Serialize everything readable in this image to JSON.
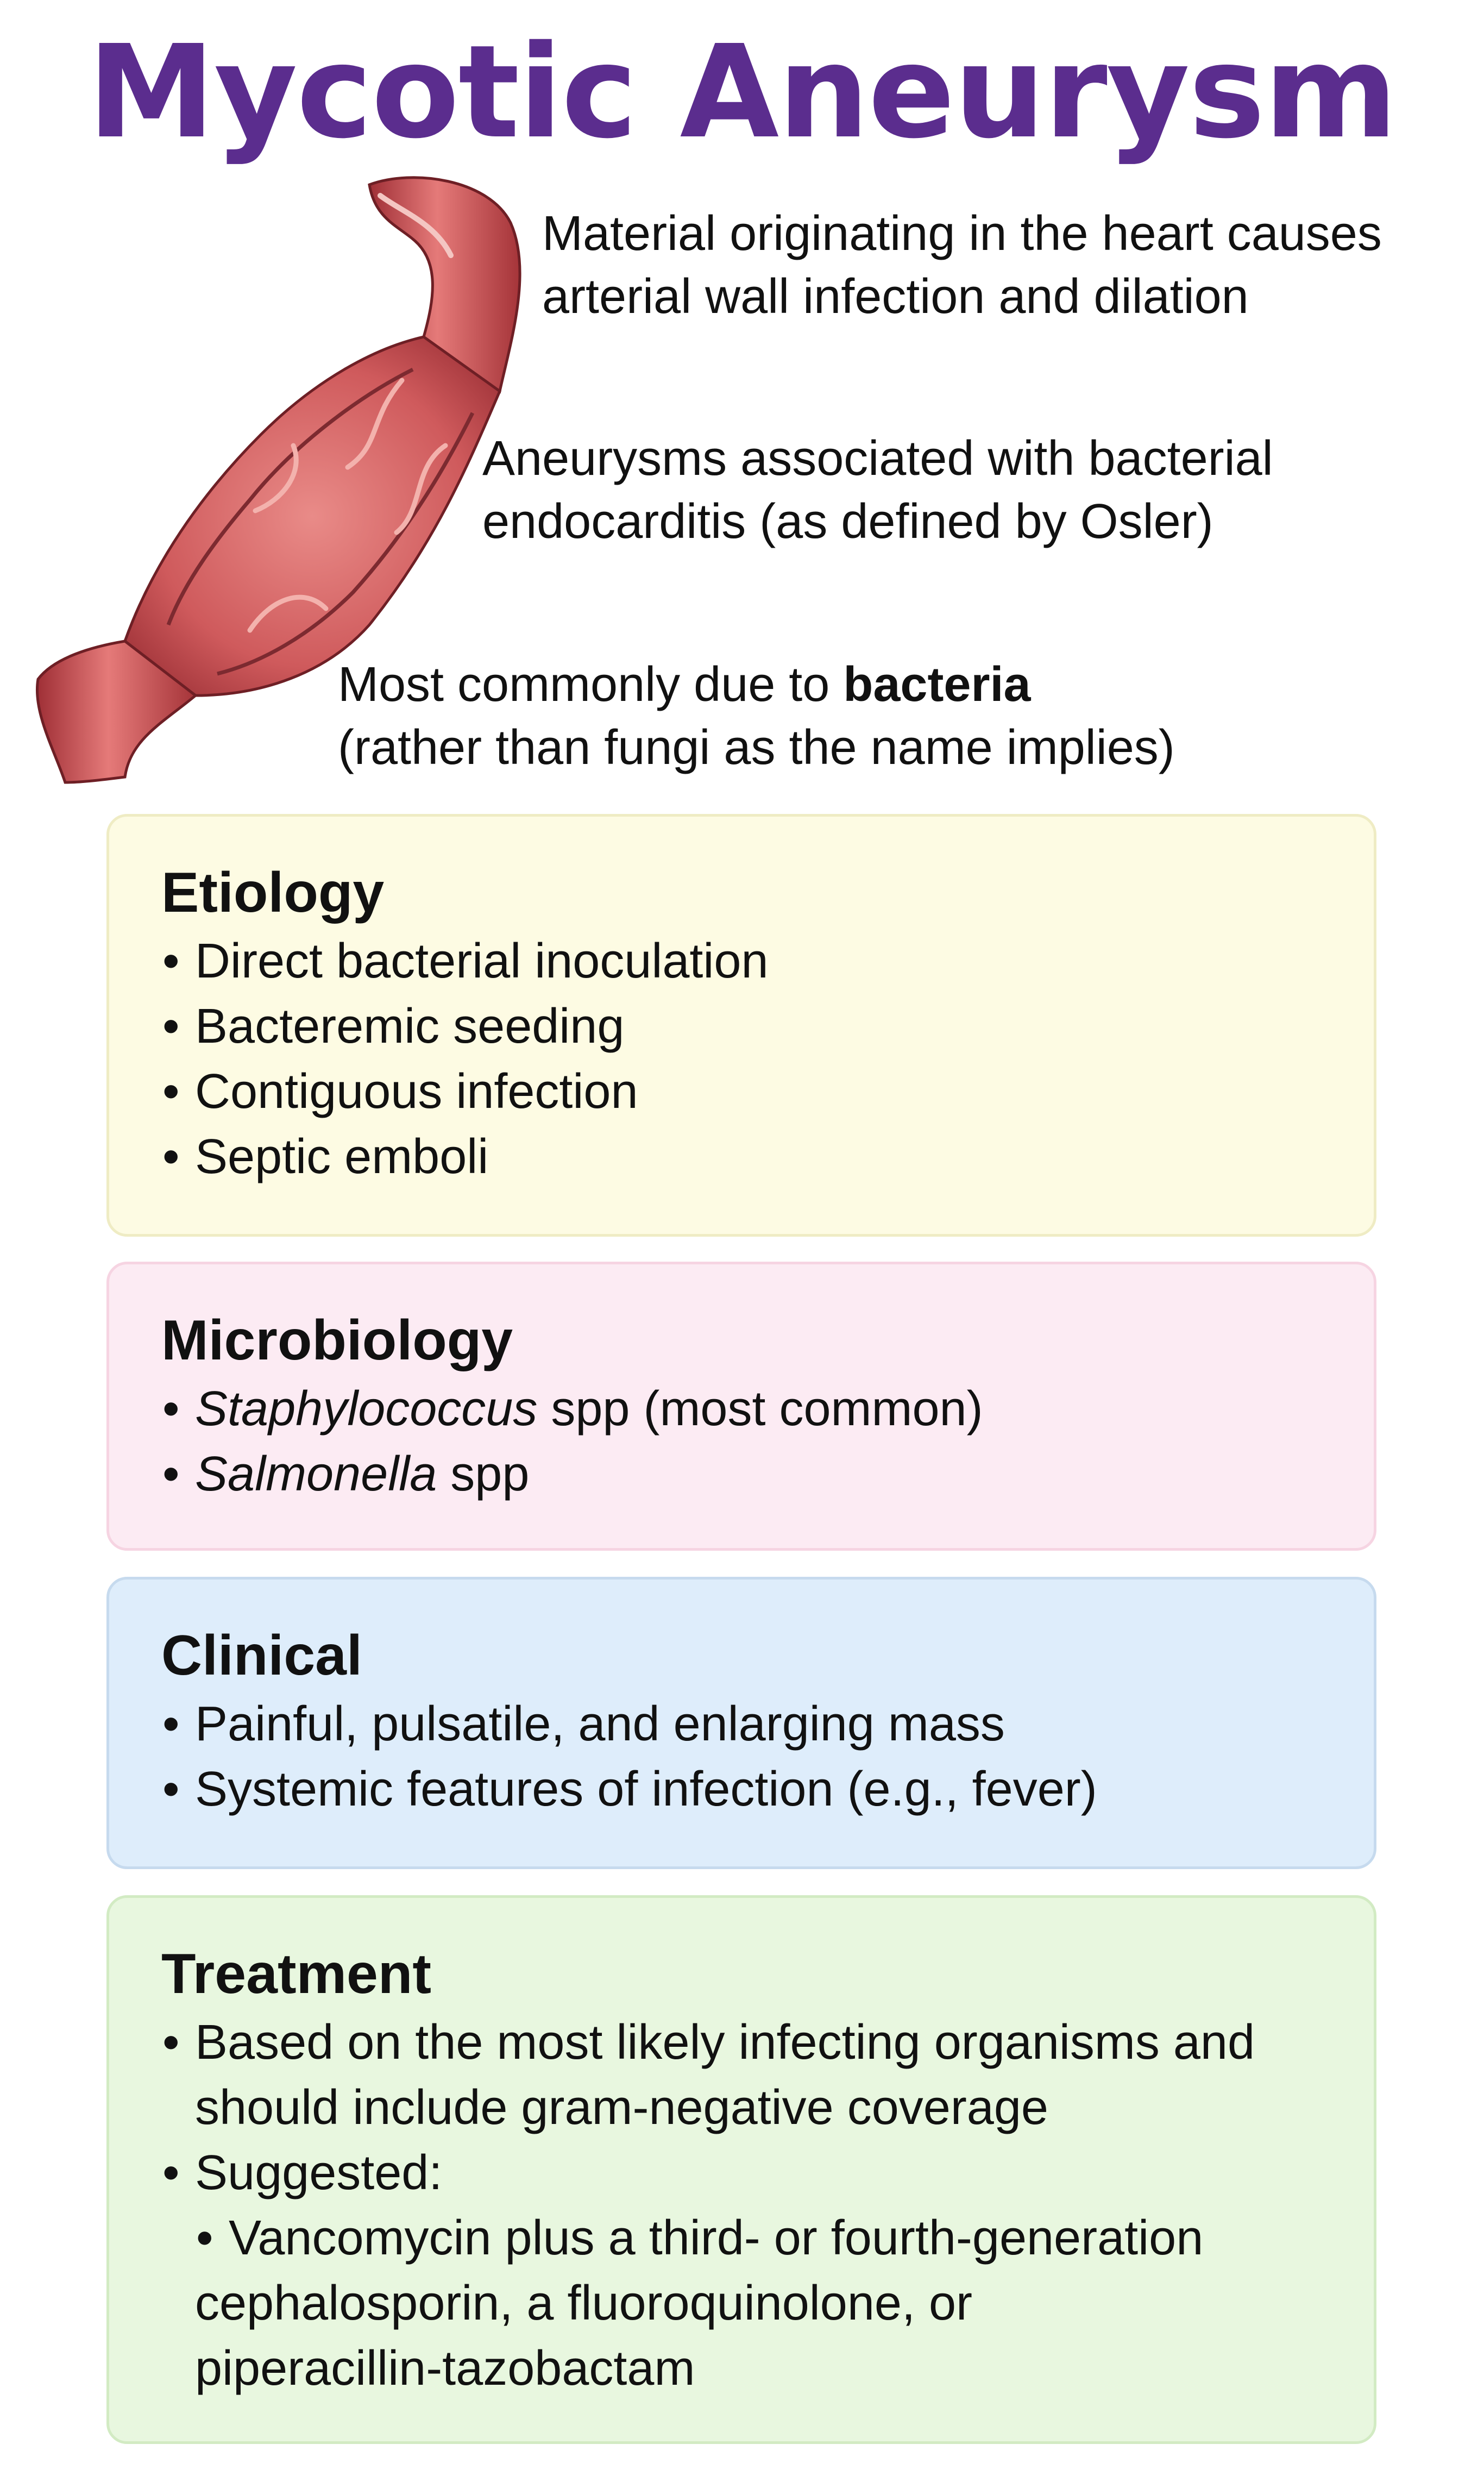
{
  "title": "Mycotic Aneurysm",
  "intro": {
    "line1a": "Material originating in the heart causes",
    "line1b": "arterial wall infection and dilation",
    "line2a": "Aneurysms associated with bacterial",
    "line2b": "endocarditis (as defined by Osler)",
    "line3a_pre": "Most commonly due to ",
    "line3a_bold": "bacteria",
    "line3b": "(rather than fungi as the name implies)"
  },
  "etiology": {
    "heading": "Etiology",
    "items": [
      "Direct bacterial inoculation",
      "Bacteremic seeding",
      "Contiguous infection",
      "Septic emboli"
    ]
  },
  "microbiology": {
    "heading": "Microbiology",
    "items": [
      {
        "italic": "Staphylococcus",
        "rest": " spp (most common)"
      },
      {
        "italic": "Salmonella",
        "rest": " spp"
      }
    ]
  },
  "clinical": {
    "heading": "Clinical",
    "items": [
      "Painful, pulsatile, and enlarging mass",
      "Systemic features of infection (e.g., fever)"
    ]
  },
  "treatment": {
    "heading": "Treatment",
    "item1a": "Based on the most likely infecting organisms and",
    "item1b": "should include gram-negative coverage",
    "item2": "Suggested:",
    "sub1a": "Vancomycin plus a third- or fourth-generation",
    "sub1b": "cephalosporin, a fluoroquinolone, or",
    "sub1c": "piperacillin-tazobactam"
  },
  "colors": {
    "title": "#5b2d8e",
    "artery": "#c94a4f",
    "etiology_bg": "#fdfbe3",
    "microbiology_bg": "#fcebf3",
    "clinical_bg": "#deedfb",
    "treatment_bg": "#e8f7df"
  }
}
